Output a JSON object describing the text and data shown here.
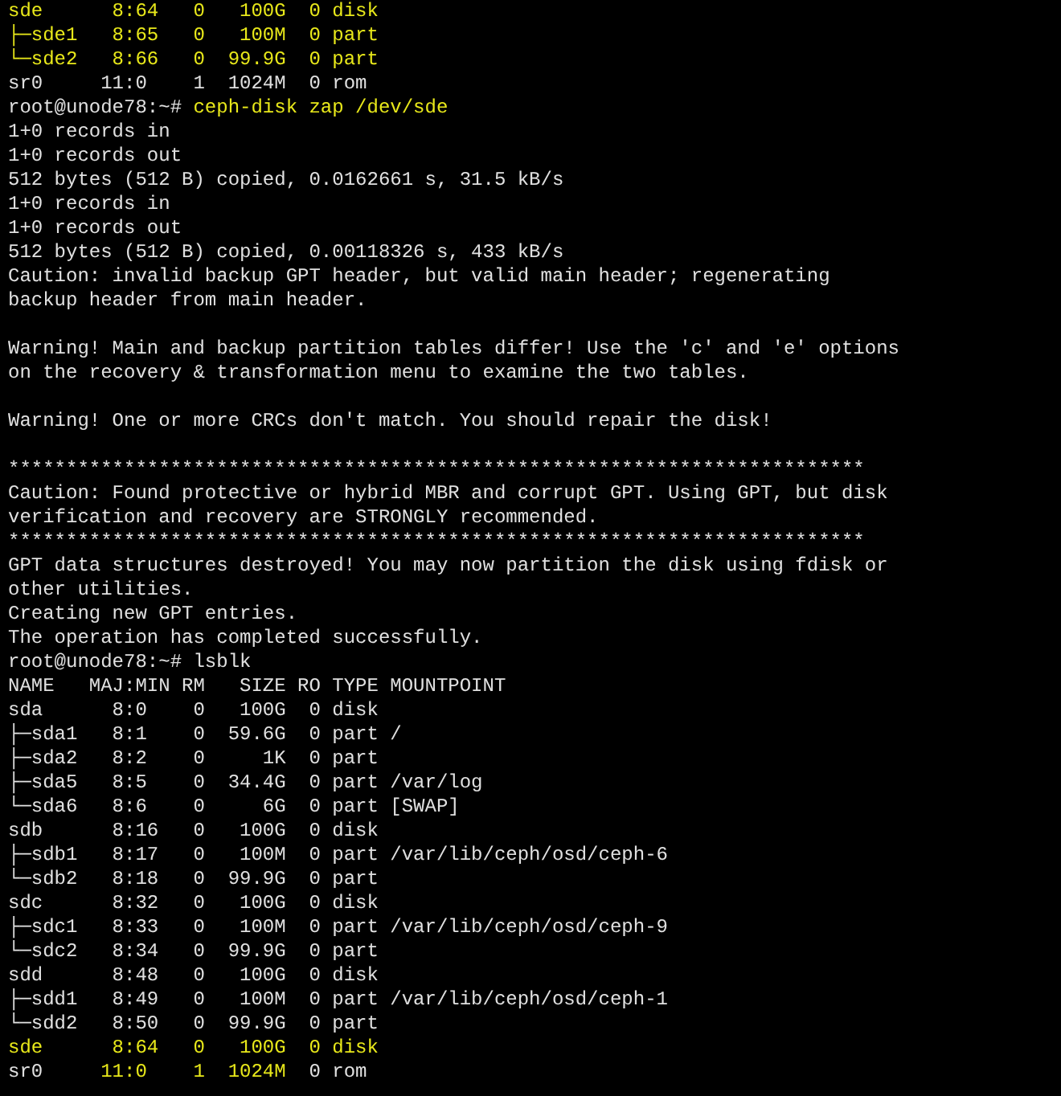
{
  "terminal": {
    "lines": [
      {
        "kind": "output",
        "segments": [
          {
            "text": "sde      8:64   0   100G  0 disk",
            "highlighted": true
          }
        ]
      },
      {
        "kind": "output",
        "segments": [
          {
            "text": "├─sde1   8:65   0   100M  0 part",
            "highlighted": true
          }
        ]
      },
      {
        "kind": "output",
        "segments": [
          {
            "text": "└─sde2   8:66   0  99.9G  0 part",
            "highlighted": true
          }
        ]
      },
      {
        "kind": "output",
        "segments": [
          {
            "text": "sr0     11:0    1  1024M  0 rom",
            "highlighted": false
          }
        ]
      },
      {
        "kind": "prompt",
        "prompt": "root@unode78:~#",
        "command": "ceph-disk zap /dev/sde",
        "highlighted": true
      },
      {
        "kind": "output",
        "segments": [
          {
            "text": "1+0 records in",
            "highlighted": false
          }
        ]
      },
      {
        "kind": "output",
        "segments": [
          {
            "text": "1+0 records out",
            "highlighted": false
          }
        ]
      },
      {
        "kind": "output",
        "segments": [
          {
            "text": "512 bytes (512 B) copied, 0.0162661 s, 31.5 kB/s",
            "highlighted": false
          }
        ]
      },
      {
        "kind": "output",
        "segments": [
          {
            "text": "1+0 records in",
            "highlighted": false
          }
        ]
      },
      {
        "kind": "output",
        "segments": [
          {
            "text": "1+0 records out",
            "highlighted": false
          }
        ]
      },
      {
        "kind": "output",
        "segments": [
          {
            "text": "512 bytes (512 B) copied, 0.00118326 s, 433 kB/s",
            "highlighted": false
          }
        ]
      },
      {
        "kind": "output",
        "segments": [
          {
            "text": "Caution: invalid backup GPT header, but valid main header; regenerating",
            "highlighted": false
          }
        ]
      },
      {
        "kind": "output",
        "segments": [
          {
            "text": "backup header from main header.",
            "highlighted": false
          }
        ]
      },
      {
        "kind": "blank"
      },
      {
        "kind": "output",
        "segments": [
          {
            "text": "Warning! Main and backup partition tables differ! Use the 'c' and 'e' options",
            "highlighted": false
          }
        ]
      },
      {
        "kind": "output",
        "segments": [
          {
            "text": "on the recovery & transformation menu to examine the two tables.",
            "highlighted": false
          }
        ]
      },
      {
        "kind": "blank"
      },
      {
        "kind": "output",
        "segments": [
          {
            "text": "Warning! One or more CRCs don't match. You should repair the disk!",
            "highlighted": false
          }
        ]
      },
      {
        "kind": "blank"
      },
      {
        "kind": "output",
        "segments": [
          {
            "text": "**************************************************************************",
            "highlighted": false
          }
        ]
      },
      {
        "kind": "output",
        "segments": [
          {
            "text": "Caution: Found protective or hybrid MBR and corrupt GPT. Using GPT, but disk",
            "highlighted": false
          }
        ]
      },
      {
        "kind": "output",
        "segments": [
          {
            "text": "verification and recovery are STRONGLY recommended.",
            "highlighted": false
          }
        ]
      },
      {
        "kind": "output",
        "segments": [
          {
            "text": "**************************************************************************",
            "highlighted": false
          }
        ]
      },
      {
        "kind": "output",
        "segments": [
          {
            "text": "GPT data structures destroyed! You may now partition the disk using fdisk or",
            "highlighted": false
          }
        ]
      },
      {
        "kind": "output",
        "segments": [
          {
            "text": "other utilities.",
            "highlighted": false
          }
        ]
      },
      {
        "kind": "output",
        "segments": [
          {
            "text": "Creating new GPT entries.",
            "highlighted": false
          }
        ]
      },
      {
        "kind": "output",
        "segments": [
          {
            "text": "The operation has completed successfully.",
            "highlighted": false
          }
        ]
      },
      {
        "kind": "prompt",
        "prompt": "root@unode78:~#",
        "command": "lsblk",
        "highlighted": false
      },
      {
        "kind": "output",
        "segments": [
          {
            "text": "NAME   MAJ:MIN RM   SIZE RO TYPE MOUNTPOINT",
            "highlighted": false
          }
        ]
      },
      {
        "kind": "output",
        "segments": [
          {
            "text": "sda      8:0    0   100G  0 disk",
            "highlighted": false
          }
        ]
      },
      {
        "kind": "output",
        "segments": [
          {
            "text": "├─sda1   8:1    0  59.6G  0 part /",
            "highlighted": false
          }
        ]
      },
      {
        "kind": "output",
        "segments": [
          {
            "text": "├─sda2   8:2    0     1K  0 part",
            "highlighted": false
          }
        ]
      },
      {
        "kind": "output",
        "segments": [
          {
            "text": "├─sda5   8:5    0  34.4G  0 part /var/log",
            "highlighted": false
          }
        ]
      },
      {
        "kind": "output",
        "segments": [
          {
            "text": "└─sda6   8:6    0     6G  0 part [SWAP]",
            "highlighted": false
          }
        ]
      },
      {
        "kind": "output",
        "segments": [
          {
            "text": "sdb      8:16   0   100G  0 disk",
            "highlighted": false
          }
        ]
      },
      {
        "kind": "output",
        "segments": [
          {
            "text": "├─sdb1   8:17   0   100M  0 part /var/lib/ceph/osd/ceph-6",
            "highlighted": false
          }
        ]
      },
      {
        "kind": "output",
        "segments": [
          {
            "text": "└─sdb2   8:18   0  99.9G  0 part",
            "highlighted": false
          }
        ]
      },
      {
        "kind": "output",
        "segments": [
          {
            "text": "sdc      8:32   0   100G  0 disk",
            "highlighted": false
          }
        ]
      },
      {
        "kind": "output",
        "segments": [
          {
            "text": "├─sdc1   8:33   0   100M  0 part /var/lib/ceph/osd/ceph-9",
            "highlighted": false
          }
        ]
      },
      {
        "kind": "output",
        "segments": [
          {
            "text": "└─sdc2   8:34   0  99.9G  0 part",
            "highlighted": false
          }
        ]
      },
      {
        "kind": "output",
        "segments": [
          {
            "text": "sdd      8:48   0   100G  0 disk",
            "highlighted": false
          }
        ]
      },
      {
        "kind": "output",
        "segments": [
          {
            "text": "├─sdd1   8:49   0   100M  0 part /var/lib/ceph/osd/ceph-1",
            "highlighted": false
          }
        ]
      },
      {
        "kind": "output",
        "segments": [
          {
            "text": "└─sdd2   8:50   0  99.9G  0 part",
            "highlighted": false
          }
        ]
      },
      {
        "kind": "output",
        "segments": [
          {
            "text": "sde      8:64   0   100G  0 disk",
            "highlighted": true
          }
        ]
      },
      {
        "kind": "output",
        "segments": [
          {
            "text": "sr0     ",
            "highlighted": false
          },
          {
            "text": "11:0    1  1024M",
            "highlighted": true
          },
          {
            "text": "  0 rom",
            "highlighted": false
          }
        ]
      }
    ]
  }
}
